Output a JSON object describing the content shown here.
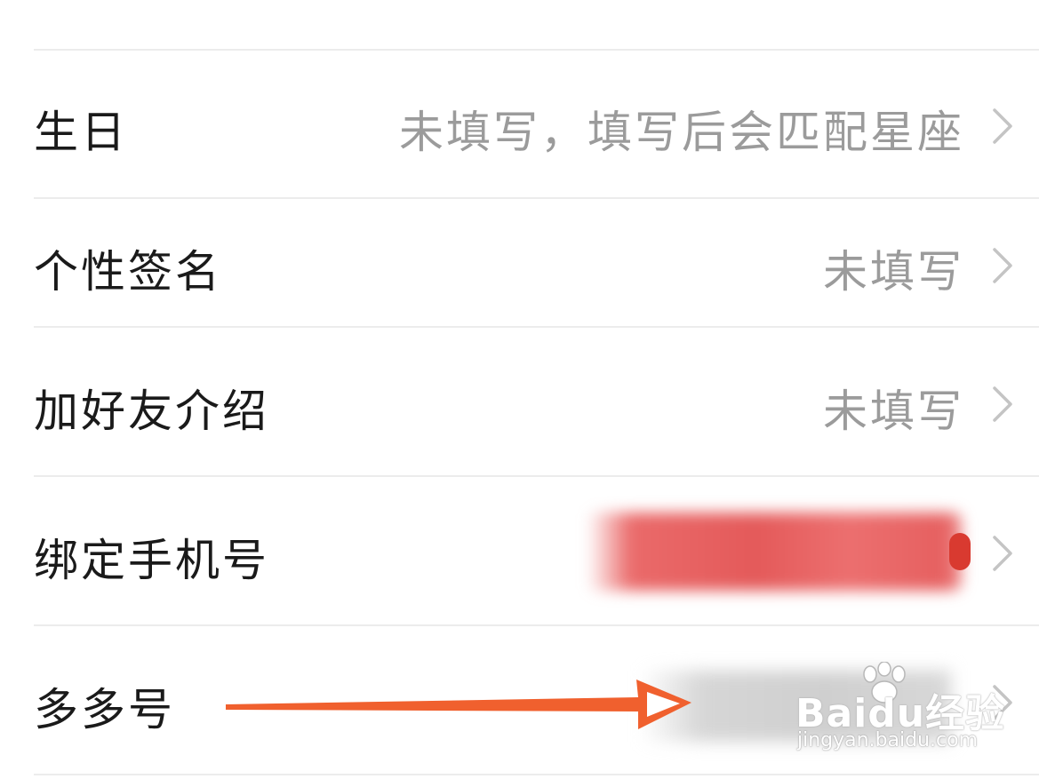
{
  "rows": [
    {
      "label": "生日",
      "value": "未填写，填写后会匹配星座"
    },
    {
      "label": "个性签名",
      "value": "未填写"
    },
    {
      "label": "加好友介绍",
      "value": "未填写"
    },
    {
      "label": "绑定手机号",
      "value": ""
    },
    {
      "label": "多多号",
      "value": ""
    }
  ],
  "icons": {
    "chevron": "chevron-right-icon",
    "annotation": "arrow-right-icon"
  },
  "colors": {
    "label": "#1a1a1a",
    "value": "#9b9b9b",
    "divider": "#ececec",
    "arrow": "#f0602e",
    "redacted_phone": "#e45a5a"
  },
  "watermark": {
    "brand": "Baidu经验",
    "url": "jingyan.baidu.com"
  }
}
